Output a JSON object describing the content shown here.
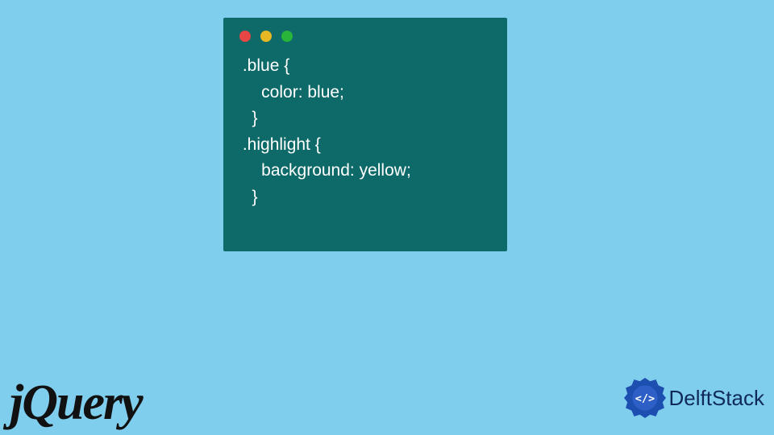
{
  "code_window": {
    "traffic_lights": {
      "red": "#e84545",
      "yellow": "#e8b824",
      "green": "#28b53a"
    },
    "code_text": " .blue {\n     color: blue;\n   }\n .highlight {\n     background: yellow;\n   }"
  },
  "logos": {
    "jquery": "jQuery",
    "delftstack": "DelftStack"
  },
  "colors": {
    "page_bg": "#80ceee",
    "code_bg": "#0e6a68",
    "code_fg": "#ffffff",
    "delft_text": "#0f2a5a",
    "delft_icon": "#1d4fb1"
  }
}
